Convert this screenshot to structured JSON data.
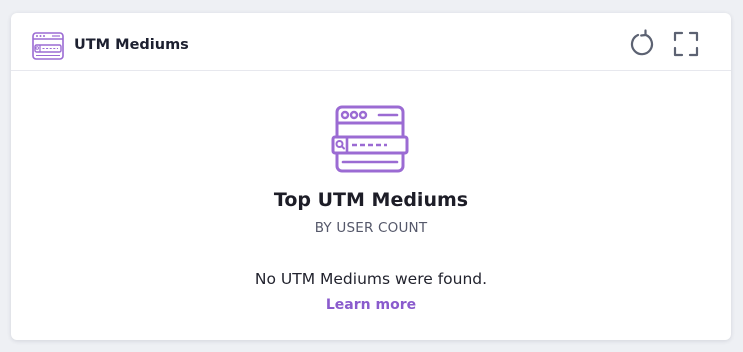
{
  "card": {
    "title": "UTM Mediums",
    "header_icon": "browser-search-icon",
    "actions": [
      {
        "name": "refresh",
        "icon": "refresh-icon"
      },
      {
        "name": "fullscreen",
        "icon": "expand-icon"
      }
    ]
  },
  "empty_state": {
    "illustration": "browser-search-icon",
    "title": "Top UTM Mediums",
    "subtitle": "BY USER COUNT",
    "message": "No UTM Mediums were found.",
    "link_label": "Learn more"
  },
  "colors": {
    "accent": "#9b6bd3",
    "icon_gray": "#5c6272",
    "link": "#8a5bcd"
  }
}
